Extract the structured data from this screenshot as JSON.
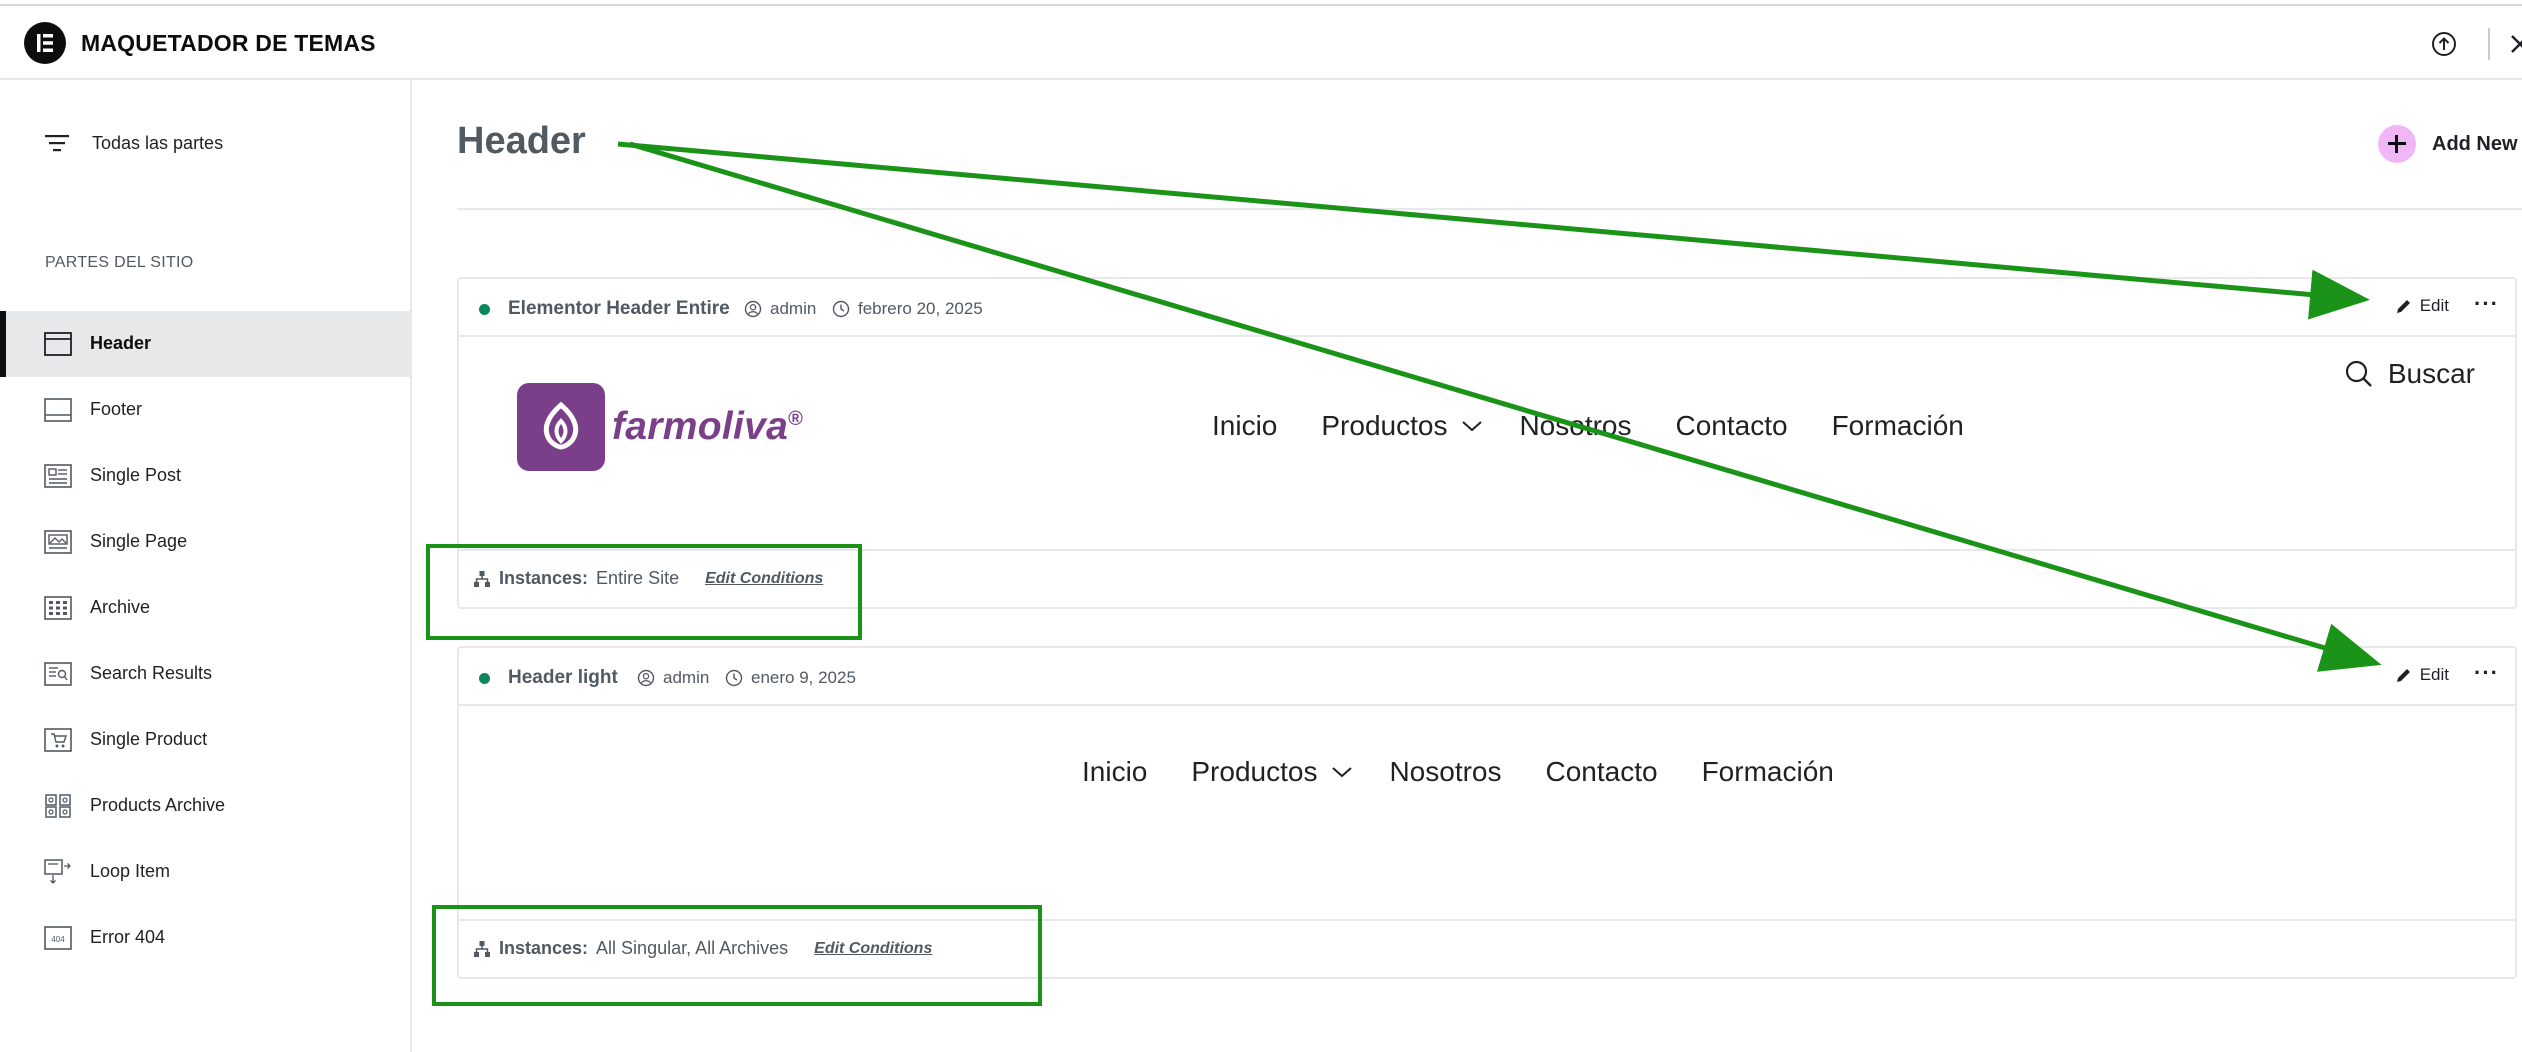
{
  "app": {
    "title": "MAQUETADOR DE TEMAS"
  },
  "sidebar": {
    "all_parts": "Todas las partes",
    "section_label": "PARTES DEL SITIO",
    "items": [
      {
        "label": "Header",
        "icon": "header-layout-icon",
        "active": true
      },
      {
        "label": "Footer",
        "icon": "footer-layout-icon"
      },
      {
        "label": "Single Post",
        "icon": "single-post-icon"
      },
      {
        "label": "Single Page",
        "icon": "single-page-icon"
      },
      {
        "label": "Archive",
        "icon": "archive-grid-icon"
      },
      {
        "label": "Search Results",
        "icon": "search-results-icon"
      },
      {
        "label": "Single Product",
        "icon": "single-product-icon"
      },
      {
        "label": "Products Archive",
        "icon": "products-archive-icon"
      },
      {
        "label": "Loop Item",
        "icon": "loop-item-icon"
      },
      {
        "label": "Error 404",
        "icon": "error-404-icon"
      }
    ]
  },
  "main": {
    "title": "Header",
    "add_new": "Add New"
  },
  "cards": [
    {
      "name": "Elementor Header Entire",
      "author": "admin",
      "date": "febrero 20, 2025",
      "edit": "Edit",
      "more": "···",
      "instances_label": "Instances:",
      "instances_value": "Entire Site",
      "edit_conditions": "Edit Conditions",
      "preview": {
        "brand": "farmoliva",
        "brand_reg": "®",
        "nav": [
          "Inicio",
          "Productos",
          "Nosotros",
          "Contacto",
          "Formación"
        ],
        "search": "Buscar"
      }
    },
    {
      "name": "Header light",
      "author": "admin",
      "date": "enero 9, 2025",
      "edit": "Edit",
      "more": "···",
      "instances_label": "Instances:",
      "instances_value": "All Singular, All Archives",
      "edit_conditions": "Edit Conditions",
      "preview": {
        "nav": [
          "Inicio",
          "Productos",
          "Nosotros",
          "Contacto",
          "Formación"
        ]
      }
    }
  ],
  "colors": {
    "accent_annotation": "#1a9318",
    "status_published": "#0a875a",
    "brand_purple": "#7b3f8a",
    "add_new_bg": "#f0b6f5"
  }
}
